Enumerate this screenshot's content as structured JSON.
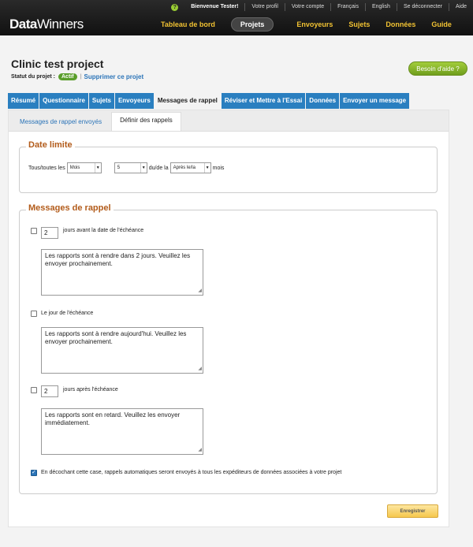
{
  "app": {
    "logo_bold": "Data",
    "logo_light": "Winners"
  },
  "utility": {
    "welcome": "Bienvenue Tester!",
    "profile": "Votre profil",
    "account": "Votre compte",
    "lang_fr": "Français",
    "lang_en": "English",
    "logout": "Se déconnecter",
    "help": "Aide",
    "help_icon": "?"
  },
  "nav": {
    "dashboard": "Tableau de bord",
    "projects": "Projets",
    "senders": "Envoyeurs",
    "subjects": "Sujets",
    "data": "Données",
    "guide": "Guide"
  },
  "project": {
    "title": "Clinic test project",
    "status_label": "Statut du projet :",
    "status": "Actif",
    "separator": "|",
    "delete": "Supprimer ce projet",
    "help_button": "Besoin d'aide ?"
  },
  "tabs": [
    "Résumé",
    "Questionnaire",
    "Sujets",
    "Envoyeurs",
    "Messages de rappel",
    "Réviser et Mettre à l'Essai",
    "Données",
    "Envoyer un message"
  ],
  "subtabs": {
    "sent": "Messages de rappel envoyés",
    "define": "Définir des rappels"
  },
  "deadline": {
    "legend": "Date limite",
    "prefix": "Tous/toutes les",
    "period": "Mois",
    "day": "5",
    "middle": "du/de la",
    "relation": "Après le/la",
    "suffix": "mois"
  },
  "reminders": {
    "legend": "Messages de rappel",
    "before": {
      "checked": false,
      "days": "2",
      "label": "jours avant la date de l'échéance",
      "message": "Les rapports sont à rendre dans 2 jours. Veuillez les envoyer prochainement."
    },
    "on": {
      "checked": false,
      "label": "Le jour de l'échéance",
      "message": "Les rapports sont à rendre aujourd'hui. Veuillez les envoyer prochainement."
    },
    "after": {
      "checked": false,
      "days": "2",
      "label": "jours après l'échéance",
      "message": "Les rapports sont en retard. Veuillez les envoyer immédiatement."
    },
    "auto": {
      "checked": true,
      "label": "En décochant cette case, rappels automatiques seront envoyés à tous les expéditeurs de données associées à votre projet"
    }
  },
  "save_label": "Enregistrer",
  "colors": {
    "accent": "#2a7fc0",
    "legend": "#b25b1a",
    "status": "#5a9e2b",
    "nav": "#f1c232"
  }
}
